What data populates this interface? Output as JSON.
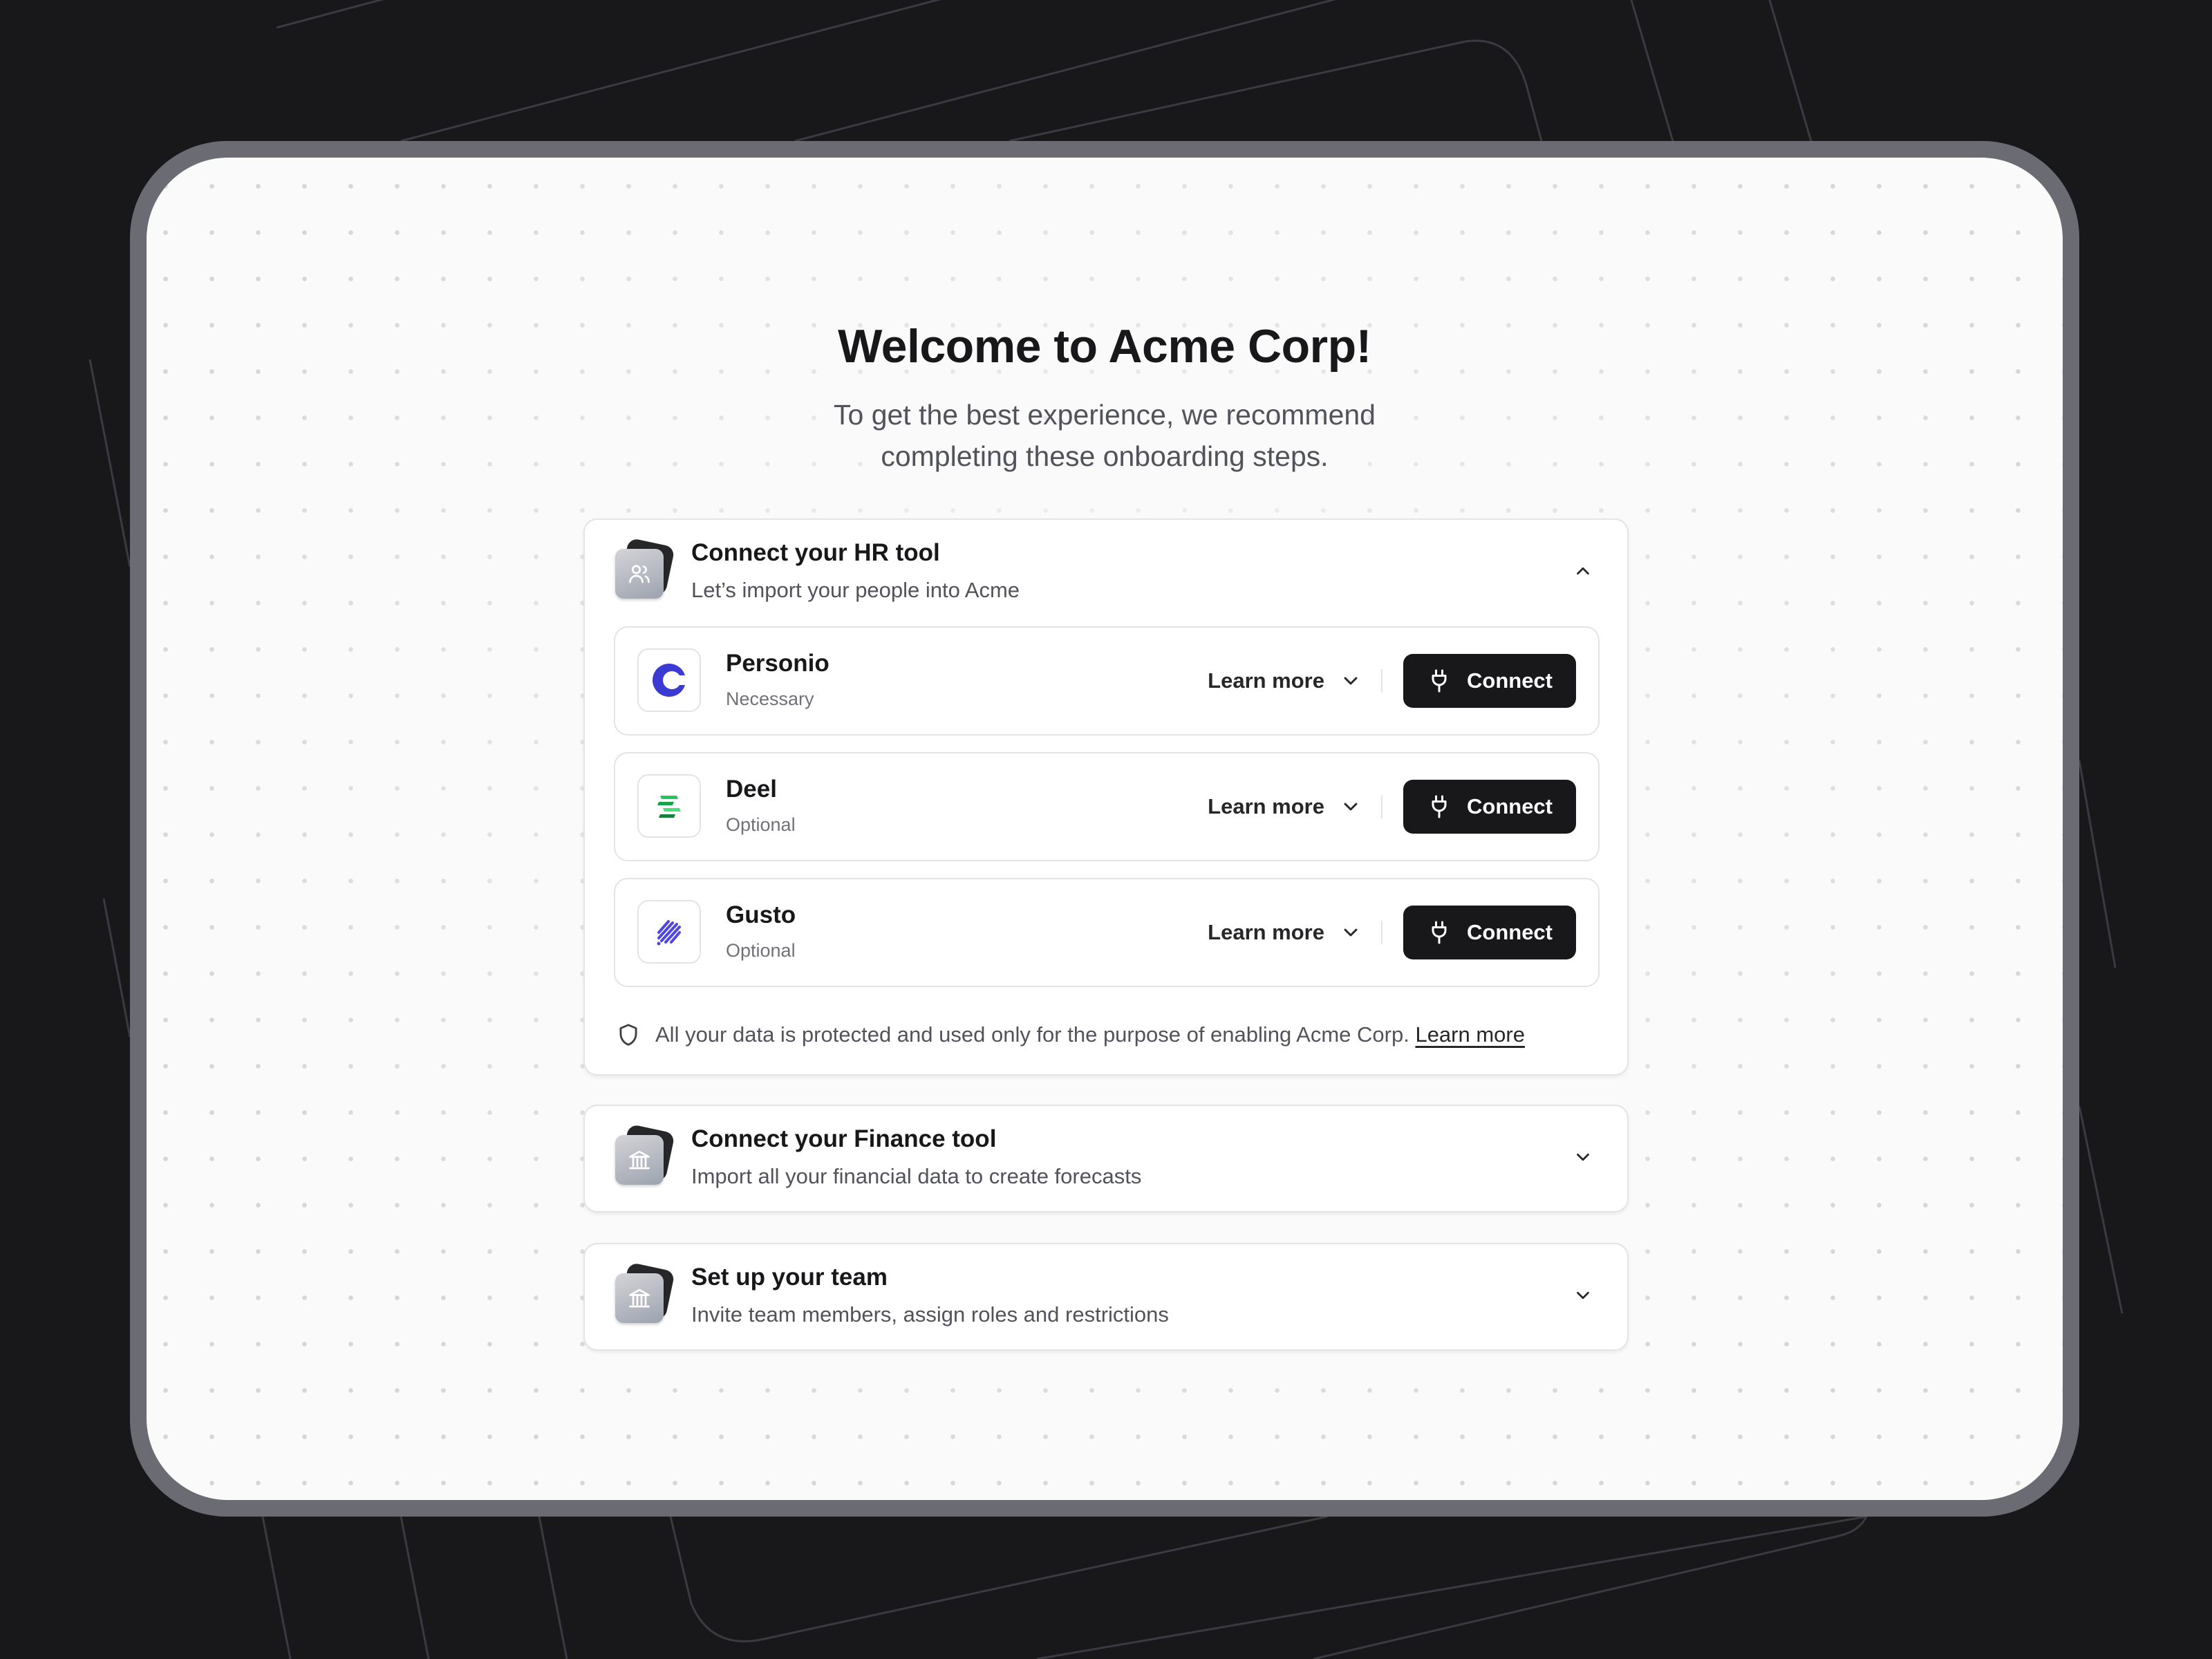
{
  "page": {
    "title": "Welcome to Acme Corp!",
    "subtitle_line1": "To get the best experience, we recommend",
    "subtitle_line2": "completing these onboarding steps."
  },
  "steps": [
    {
      "title": "Connect your HR tool",
      "description": "Let’s import your people into Acme",
      "icon": "users-icon",
      "state": "expanded",
      "integrations": [
        {
          "name": "Personio",
          "tag": "Necessary",
          "learn_label": "Learn more",
          "connect_label": "Connect",
          "logo": "personio-logo",
          "color": "#3b3bd4"
        },
        {
          "name": "Deel",
          "tag": "Optional",
          "learn_label": "Learn more",
          "connect_label": "Connect",
          "logo": "deel-logo",
          "color": "#2bb24c"
        },
        {
          "name": "Gusto",
          "tag": "Optional",
          "learn_label": "Learn more",
          "connect_label": "Connect",
          "logo": "gusto-logo",
          "color": "#4f46e5"
        }
      ],
      "privacy_note": "All your data is protected and used only for the purpose of enabling Acme Corp.",
      "privacy_link": "Learn more"
    },
    {
      "title": "Connect your Finance tool",
      "description": "Import all your financial data to create forecasts",
      "icon": "bank-icon",
      "state": "collapsed"
    },
    {
      "title": "Set up your team",
      "description": "Invite team members, assign roles and restrictions",
      "icon": "bank-icon",
      "state": "collapsed"
    }
  ],
  "colors": {
    "background": "#18181b",
    "frame": "#6b6b74",
    "screen": "#fafafa",
    "button": "#18181b"
  }
}
